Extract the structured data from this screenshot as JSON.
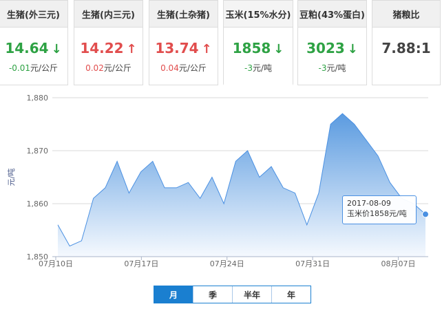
{
  "cards": [
    {
      "title": "生猪(外三元)",
      "price": "14.64",
      "dir": "down",
      "change": "-0.01元/公斤"
    },
    {
      "title": "生猪(内三元)",
      "price": "14.22",
      "dir": "up",
      "change": "0.02元/公斤"
    },
    {
      "title": "生猪(土杂猪)",
      "price": "13.74",
      "dir": "up",
      "change": "0.04元/公斤"
    },
    {
      "title": "玉米(15%水分)",
      "price": "1858",
      "dir": "down",
      "change": "-3元/吨"
    },
    {
      "title": "豆粕(43%蛋白)",
      "price": "3023",
      "dir": "down",
      "change": "-3元/吨"
    },
    {
      "title": "猪粮比",
      "price": "7.88:1",
      "dir": "none",
      "change": ""
    }
  ],
  "colors": {
    "up": "#e14d4d",
    "down": "#2ea244",
    "line": "#4a90e2",
    "fill_top": "#5b9be0",
    "fill_bottom": "#f5f9fe"
  },
  "icons": {
    "up": "arrow-up-icon",
    "down": "arrow-down-icon"
  },
  "tooltip": {
    "date": "2017-08-09",
    "text": "玉米价1858元/吨"
  },
  "range_buttons": [
    {
      "label": "月",
      "selected": true
    },
    {
      "label": "季",
      "selected": false
    },
    {
      "label": "半年",
      "selected": false
    },
    {
      "label": "年",
      "selected": false
    }
  ],
  "chart_data": {
    "type": "area",
    "title": "",
    "ylabel": "元/吨",
    "ylim": [
      1850,
      1880
    ],
    "yticks": [
      1850,
      1860,
      1870,
      1880
    ],
    "ytick_labels": [
      "1,850",
      "1,860",
      "1,870",
      "1,880"
    ],
    "xtick_labels": [
      "07月10日",
      "07月17日",
      "07月24日",
      "07月31日",
      "08月07日"
    ],
    "xtick_index": [
      0,
      10,
      20,
      30,
      40
    ],
    "grid": true,
    "series": [
      {
        "values": [
          1856,
          1852,
          1853,
          1861,
          1863,
          1868,
          1862,
          1866,
          1868,
          1863,
          1863,
          1864,
          1861,
          1865,
          1860,
          1868,
          1870,
          1865,
          1867,
          1863,
          1862,
          1856,
          1862,
          1875,
          1877,
          1875,
          1872,
          1869,
          1864,
          1861,
          1860,
          1858
        ]
      }
    ],
    "highlight_index": 31,
    "highlight_value": 1858
  }
}
